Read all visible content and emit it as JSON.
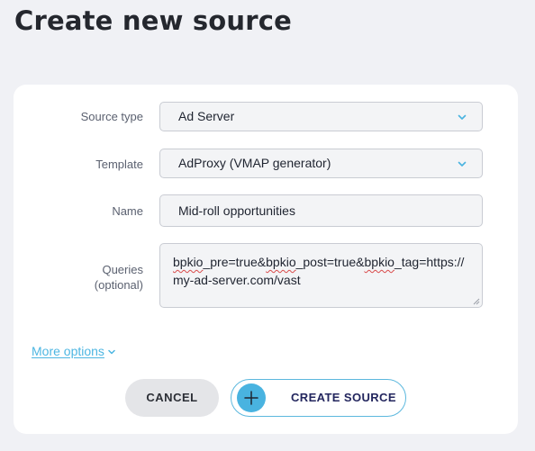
{
  "page": {
    "title": "Create new source"
  },
  "form": {
    "source_type": {
      "label": "Source type",
      "value": "Ad Server"
    },
    "template": {
      "label": "Template",
      "value": "AdProxy (VMAP generator)"
    },
    "name": {
      "label": "Name",
      "value": "Mid-roll opportunities"
    },
    "queries": {
      "label": "Queries",
      "sublabel": "(optional)",
      "parts": [
        "bpkio",
        "_pre=true&",
        "bpkio",
        "_post=true&",
        "bpkio",
        "_tag=https://my-ad-server.com/vast"
      ]
    },
    "more_options": "More options"
  },
  "actions": {
    "cancel_label": "CANCEL",
    "create_label": "CREATE SOURCE"
  },
  "colors": {
    "background": "#f0f1f5",
    "card": "#ffffff",
    "accent": "#49b3e0",
    "create_text": "#23265e",
    "spellcheck": "#d94b4b"
  },
  "icons": {
    "select_chevron": "chevron-down-icon",
    "more_chevron": "chevron-down-icon",
    "create_plus": "plus-icon"
  }
}
